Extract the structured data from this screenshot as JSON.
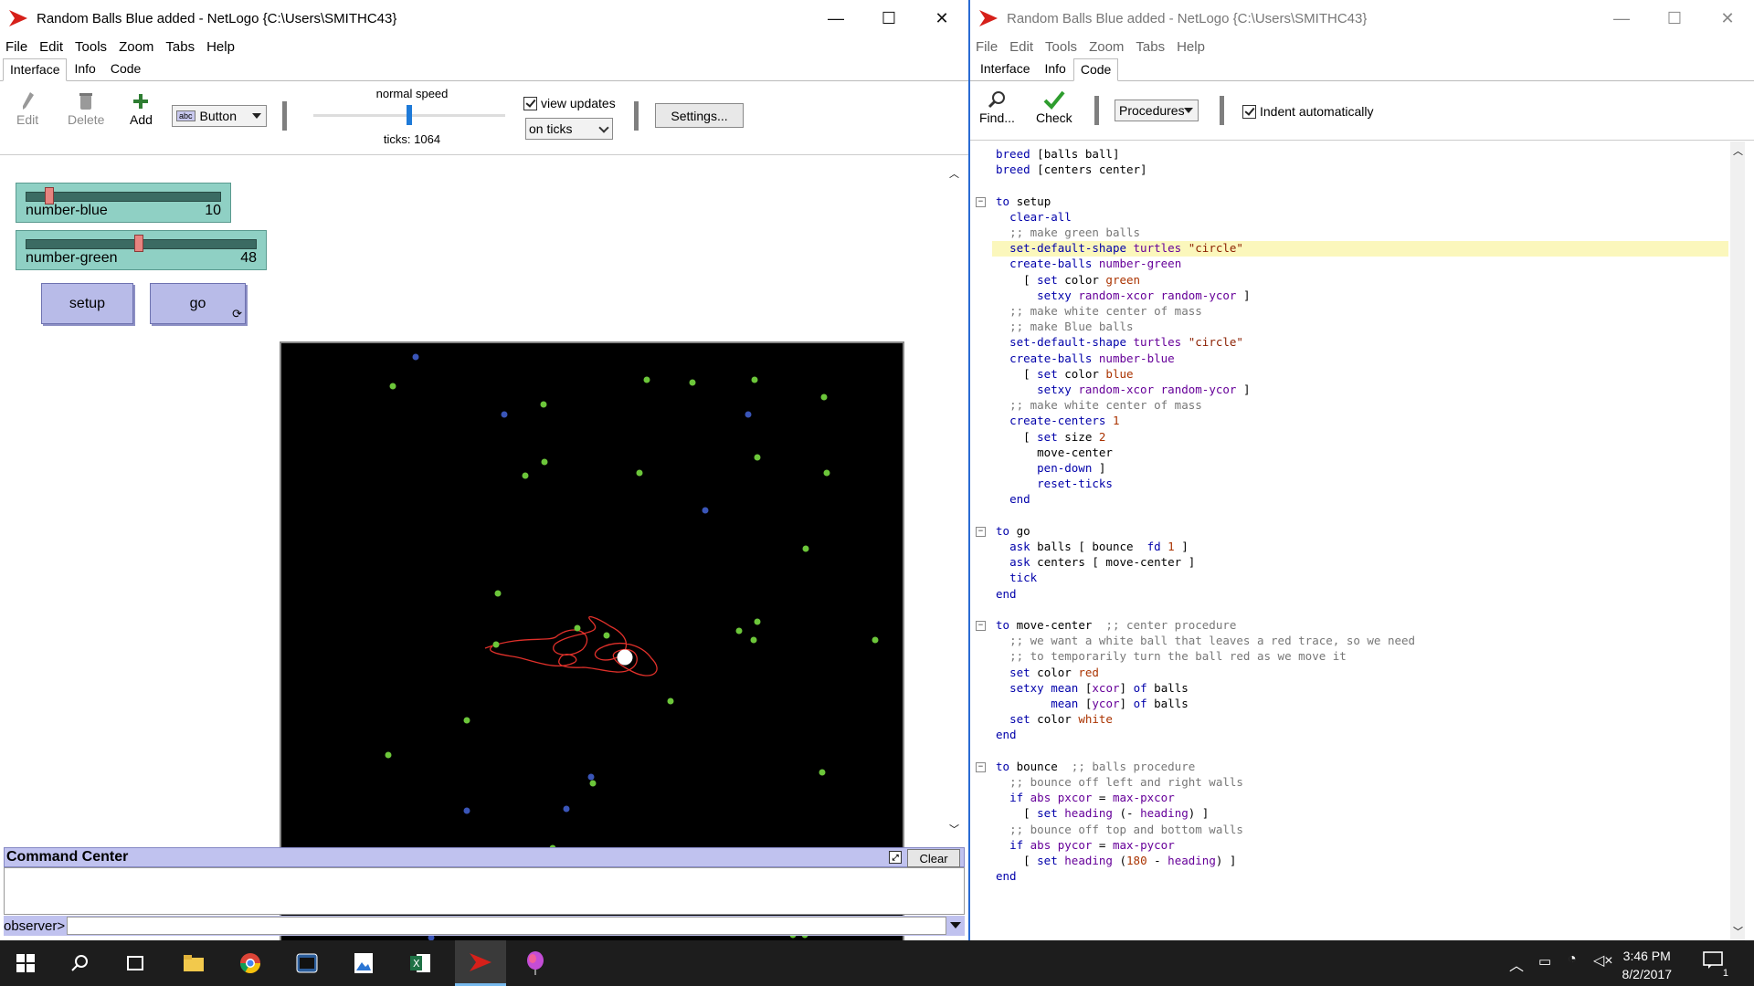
{
  "left_window": {
    "title": "Random Balls Blue added - NetLogo {C:\\Users\\SMITHC43}",
    "controls": {
      "minimize": "—",
      "maximize": "☐",
      "close": "✕"
    },
    "menu": [
      "File",
      "Edit",
      "Tools",
      "Zoom",
      "Tabs",
      "Help"
    ],
    "tabs": [
      "Interface",
      "Info",
      "Code"
    ],
    "toolbar": {
      "edit": "Edit",
      "delete": "Delete",
      "add": "Add",
      "widget_type": "Button",
      "widget_tag": "abc",
      "speed_label": "normal speed",
      "speed_value": 0.5,
      "ticks_label": "ticks: 1064",
      "view_updates": "view updates",
      "update_mode": "on ticks",
      "settings": "Settings..."
    },
    "widgets": {
      "slider_blue": {
        "label": "number-blue",
        "value": "10",
        "fraction": 0.1
      },
      "slider_green": {
        "label": "number-green",
        "value": "48",
        "fraction": 0.48
      },
      "setup": "setup",
      "go": "go"
    },
    "command_center": {
      "title": "Command Center",
      "clear": "Clear",
      "prompt": "observer>"
    }
  },
  "right_window": {
    "title": "Random Balls Blue added - NetLogo {C:\\Users\\SMITHC43}",
    "controls": {
      "minimize": "—",
      "maximize": "☐",
      "close": "✕"
    },
    "menu": [
      "File",
      "Edit",
      "Tools",
      "Zoom",
      "Tabs",
      "Help"
    ],
    "tabs": [
      "Interface",
      "Info",
      "Code"
    ],
    "toolbar": {
      "find": "Find...",
      "check": "Check",
      "procedures": "Procedures",
      "indent": "Indent automatically"
    }
  },
  "code_lines": [
    "breed [balls ball]",
    "breed [centers center]",
    "",
    "to setup",
    "  clear-all",
    "  ;; make green balls",
    "  set-default-shape turtles \"circle\"",
    "  create-balls number-green",
    "    [ set color green",
    "      setxy random-xcor random-ycor ]",
    "  ;; make white center of mass",
    "  ;; make Blue balls",
    "  set-default-shape turtles \"circle\"",
    "  create-balls number-blue",
    "    [ set color blue",
    "      setxy random-xcor random-ycor ]",
    "  ;; make white center of mass",
    "  create-centers 1",
    "    [ set size 2",
    "      move-center",
    "      pen-down ]",
    "      reset-ticks",
    "  end",
    "",
    "to go",
    "  ask balls [ bounce  fd 1 ]",
    "  ask centers [ move-center ]",
    "  tick",
    "end",
    "",
    "to move-center  ;; center procedure",
    "  ;; we want a white ball that leaves a red trace, so we need",
    "  ;; to temporarily turn the ball red as we move it",
    "  set color red",
    "  setxy mean [xcor] of balls",
    "        mean [ycor] of balls",
    "  set color white",
    "end",
    "",
    "to bounce  ;; balls procedure",
    "  ;; bounce off left and right walls",
    "  if abs pxcor = max-pxcor",
    "    [ set heading (- heading) ]",
    "  ;; bounce off top and bottom walls",
    "  if abs pycor = max-pycor",
    "    [ set heading (180 - heading) ]",
    "end"
  ],
  "colors": {
    "slider": "#8fd0c4",
    "button": "#b8bbe8",
    "green_ball": "#6cc63a",
    "blue_ball": "#3a55b8",
    "trace": "#e0302a",
    "highlight": "#fbf7bc"
  },
  "taskbar": {
    "time": "3:46 PM",
    "date": "8/2/2017",
    "notification_count": "1"
  }
}
